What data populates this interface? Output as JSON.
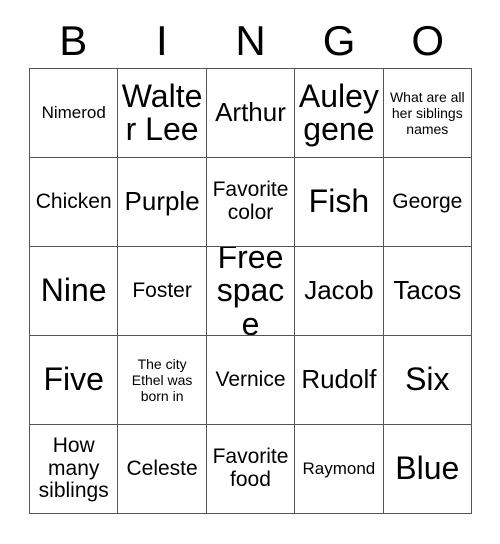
{
  "card": {
    "header_letters": [
      "B",
      "I",
      "N",
      "G",
      "O"
    ],
    "grid": {
      "rows": [
        [
          {
            "text": "Nimerod",
            "size": "sm"
          },
          {
            "text": "Walter Lee",
            "size": "xl"
          },
          {
            "text": "Arthur",
            "size": "lg"
          },
          {
            "text": "Auley gene",
            "size": "xl"
          },
          {
            "text": "What are all her siblings names",
            "size": "xs"
          }
        ],
        [
          {
            "text": "Chicken",
            "size": "md"
          },
          {
            "text": "Purple",
            "size": "lg"
          },
          {
            "text": "Favorite color",
            "size": "md"
          },
          {
            "text": "Fish",
            "size": "xl"
          },
          {
            "text": "George",
            "size": "md"
          }
        ],
        [
          {
            "text": "Nine",
            "size": "xl"
          },
          {
            "text": "Foster",
            "size": "md"
          },
          {
            "text": "Free space",
            "size": "xl"
          },
          {
            "text": "Jacob",
            "size": "lg"
          },
          {
            "text": "Tacos",
            "size": "lg"
          }
        ],
        [
          {
            "text": "Five",
            "size": "xl"
          },
          {
            "text": "The city Ethel was born in",
            "size": "xs"
          },
          {
            "text": "Vernice",
            "size": "md"
          },
          {
            "text": "Rudolf",
            "size": "lg"
          },
          {
            "text": "Six",
            "size": "xl"
          }
        ],
        [
          {
            "text": "How many siblings",
            "size": "md"
          },
          {
            "text": "Celeste",
            "size": "md"
          },
          {
            "text": "Favorite food",
            "size": "md"
          },
          {
            "text": "Raymond",
            "size": "sm"
          },
          {
            "text": "Blue",
            "size": "xl"
          }
        ]
      ]
    },
    "colors": {
      "background": "#ffffff",
      "text": "#000000",
      "grid_line": "#555555"
    }
  }
}
